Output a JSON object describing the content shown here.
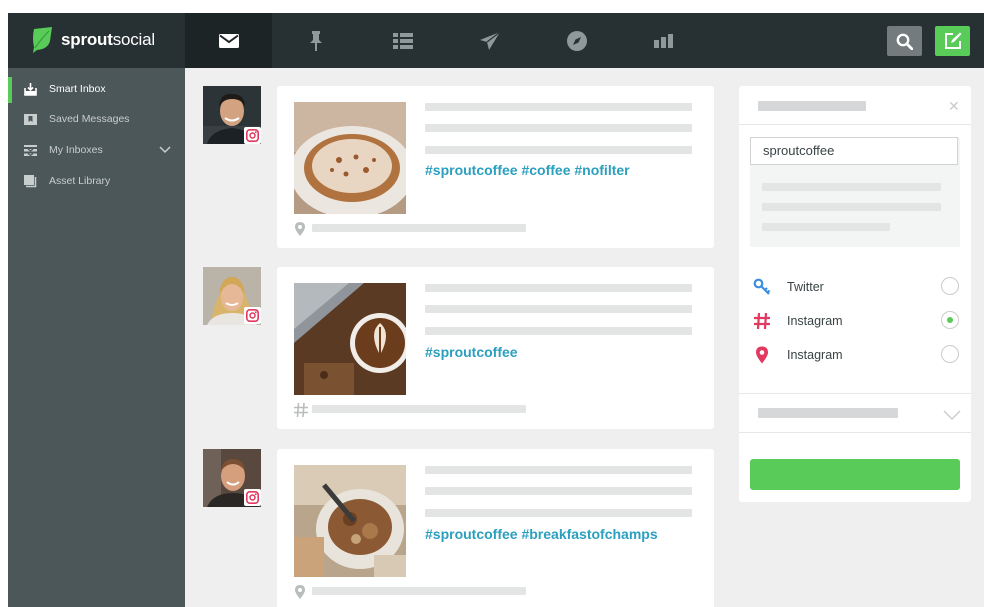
{
  "brand": {
    "name_bold": "sprout",
    "name_regular": "social",
    "accent": "#59cb59"
  },
  "topnav": {
    "items": [
      {
        "icon": "envelope-icon",
        "active": true
      },
      {
        "icon": "pin-icon",
        "active": false
      },
      {
        "icon": "list-icon",
        "active": false
      },
      {
        "icon": "paper-plane-icon",
        "active": false
      },
      {
        "icon": "compass-icon",
        "active": false
      },
      {
        "icon": "bar-chart-icon",
        "active": false
      }
    ],
    "search_icon": "search-icon",
    "compose_icon": "compose-icon"
  },
  "sidebar": {
    "items": [
      {
        "label": "Smart Inbox",
        "icon": "inbox-icon",
        "active": true
      },
      {
        "label": "Saved Messages",
        "icon": "bookmark-icon",
        "active": false
      },
      {
        "label": "My Inboxes",
        "icon": "stacked-inboxes-icon",
        "active": false,
        "expandable": true
      },
      {
        "label": "Asset Library",
        "icon": "asset-library-icon",
        "active": false
      }
    ]
  },
  "feed": {
    "messages": [
      {
        "network": "instagram",
        "hashtags": "#sproutcoffee #coffee #nofilter",
        "meta_icon": "location-pin-icon"
      },
      {
        "network": "instagram",
        "hashtags": "#sproutcoffee",
        "meta_icon": "hashtag-icon"
      },
      {
        "network": "instagram",
        "hashtags": "#sproutcoffee #breakfastofchamps",
        "meta_icon": "location-pin-icon"
      }
    ]
  },
  "panel": {
    "search_value": "sproutcoffee",
    "options": [
      {
        "label": "Twitter",
        "icon": "keyword-search-icon",
        "selected": false,
        "color": "#3d8fde"
      },
      {
        "label": "Instagram",
        "icon": "hashtag-icon",
        "selected": true,
        "color": "#e1395f"
      },
      {
        "label": "Instagram",
        "icon": "location-pin-icon",
        "selected": false,
        "color": "#e1395f"
      }
    ]
  }
}
